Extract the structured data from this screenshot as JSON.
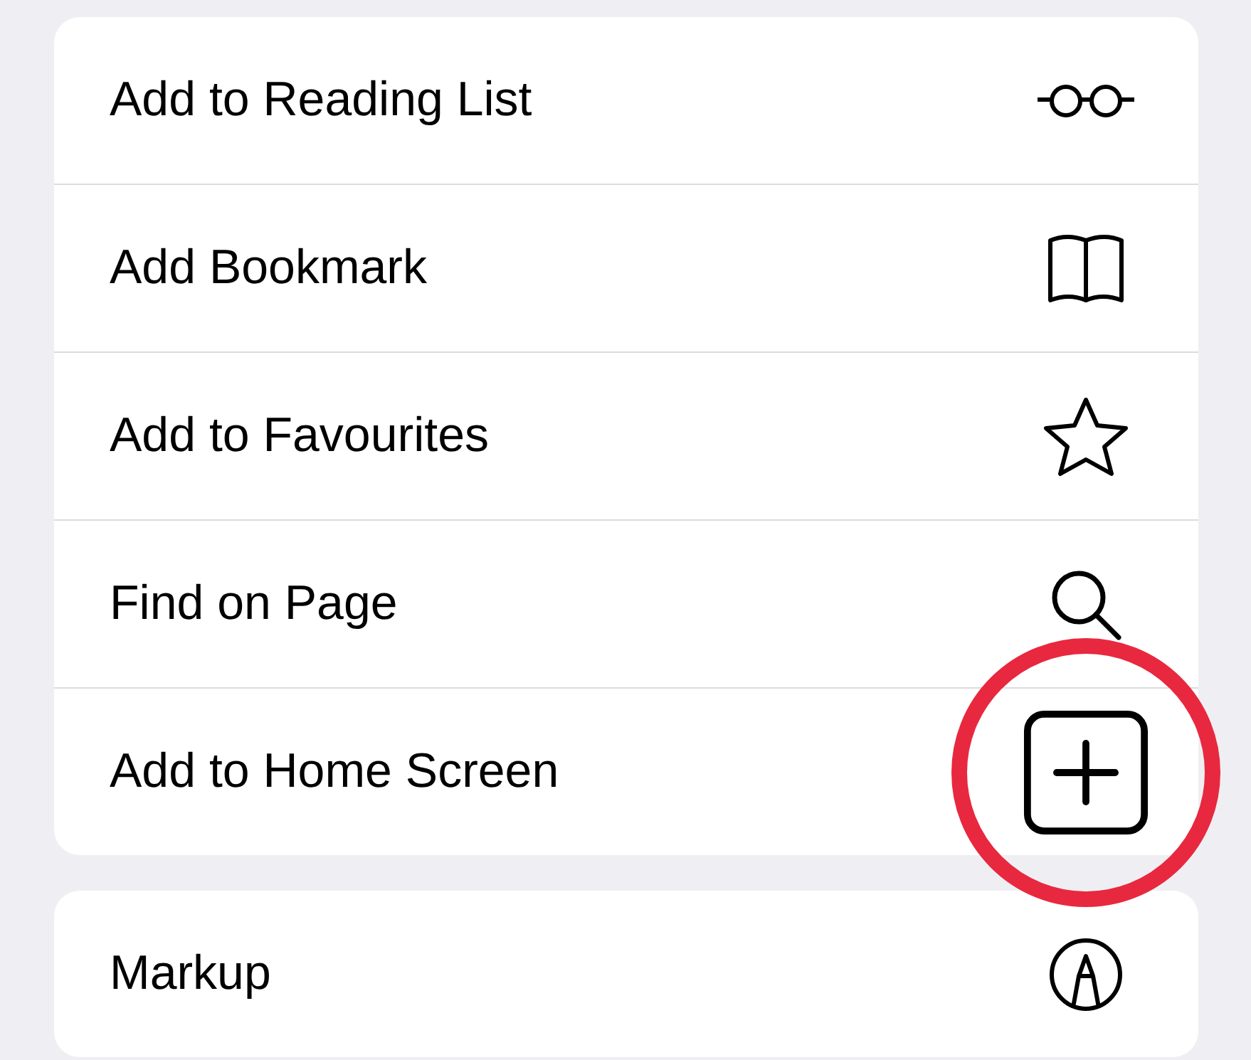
{
  "groups": [
    {
      "actions": [
        {
          "label": "Add to Reading List",
          "highlighted": false
        },
        {
          "label": "Add Bookmark",
          "highlighted": false
        },
        {
          "label": "Add to Favourites",
          "highlighted": false
        },
        {
          "label": "Find on Page",
          "highlighted": false
        },
        {
          "label": "Add to Home Screen",
          "highlighted": true
        }
      ]
    },
    {
      "actions": [
        {
          "label": "Markup",
          "highlighted": false
        }
      ]
    }
  ]
}
